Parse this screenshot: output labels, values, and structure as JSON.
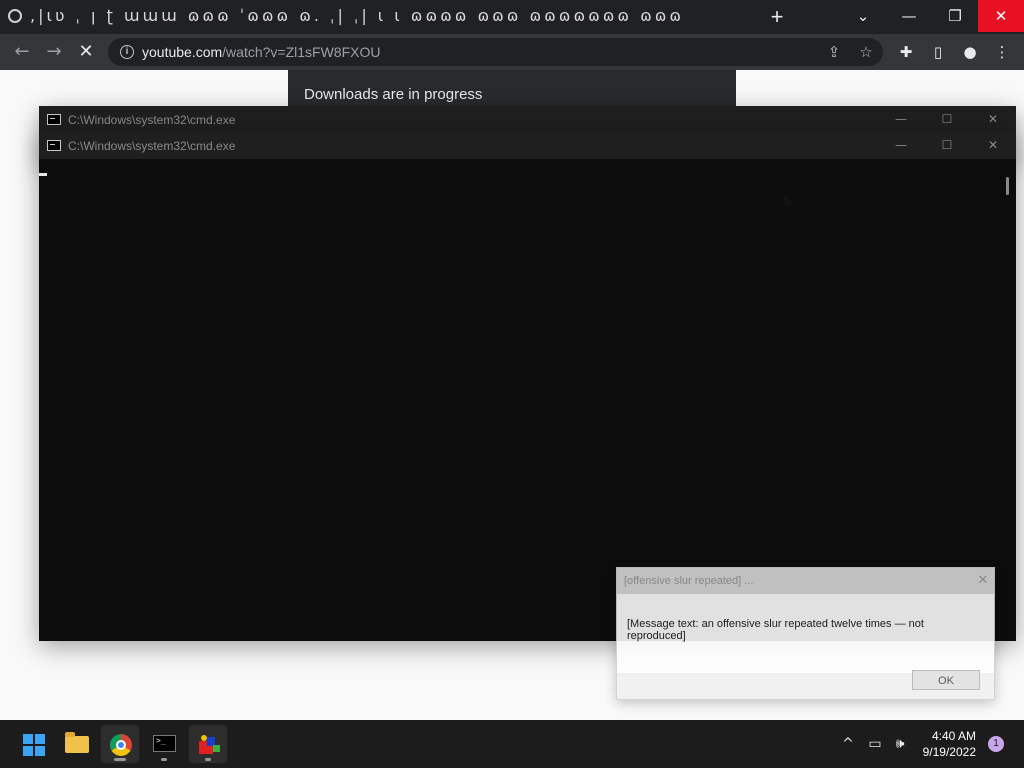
{
  "browser": {
    "tab_glyphs": ",|ɩʋ ˌ ꞁ ʈ ɯɯɯ ɷɷɷ ˈɷɷɷ ɷ. ˌ| ˌ| ɩ ɩ ɷɷɷɷ ɷɷɷ ɷɷɷɷɷɷɷ ɷɷɷ",
    "new_tab_label": "+",
    "url_host": "youtube.com",
    "url_path": "/watch?v=Zl1sFW8FXOU"
  },
  "downloads_bubble": {
    "text": "Downloads are in progress"
  },
  "cmd_windows": [
    {
      "title": "C:\\Windows\\system32\\cmd.exe"
    },
    {
      "title": "C:\\Windows\\system32\\cmd.exe"
    }
  ],
  "message_box": {
    "title": "[offensive slur repeated] ...",
    "body": "[Message text: an offensive slur repeated twelve times — not reproduced]",
    "ok_label": "OK"
  },
  "taskbar": {
    "time": "4:40 AM",
    "date": "9/19/2022",
    "notification_count": "1"
  },
  "colors": {
    "titlebar": "#202124",
    "toolbar": "#35363a",
    "close_red": "#e81123",
    "console_bg": "#0c0c0c",
    "taskbar_bg": "#1c1c1c"
  }
}
